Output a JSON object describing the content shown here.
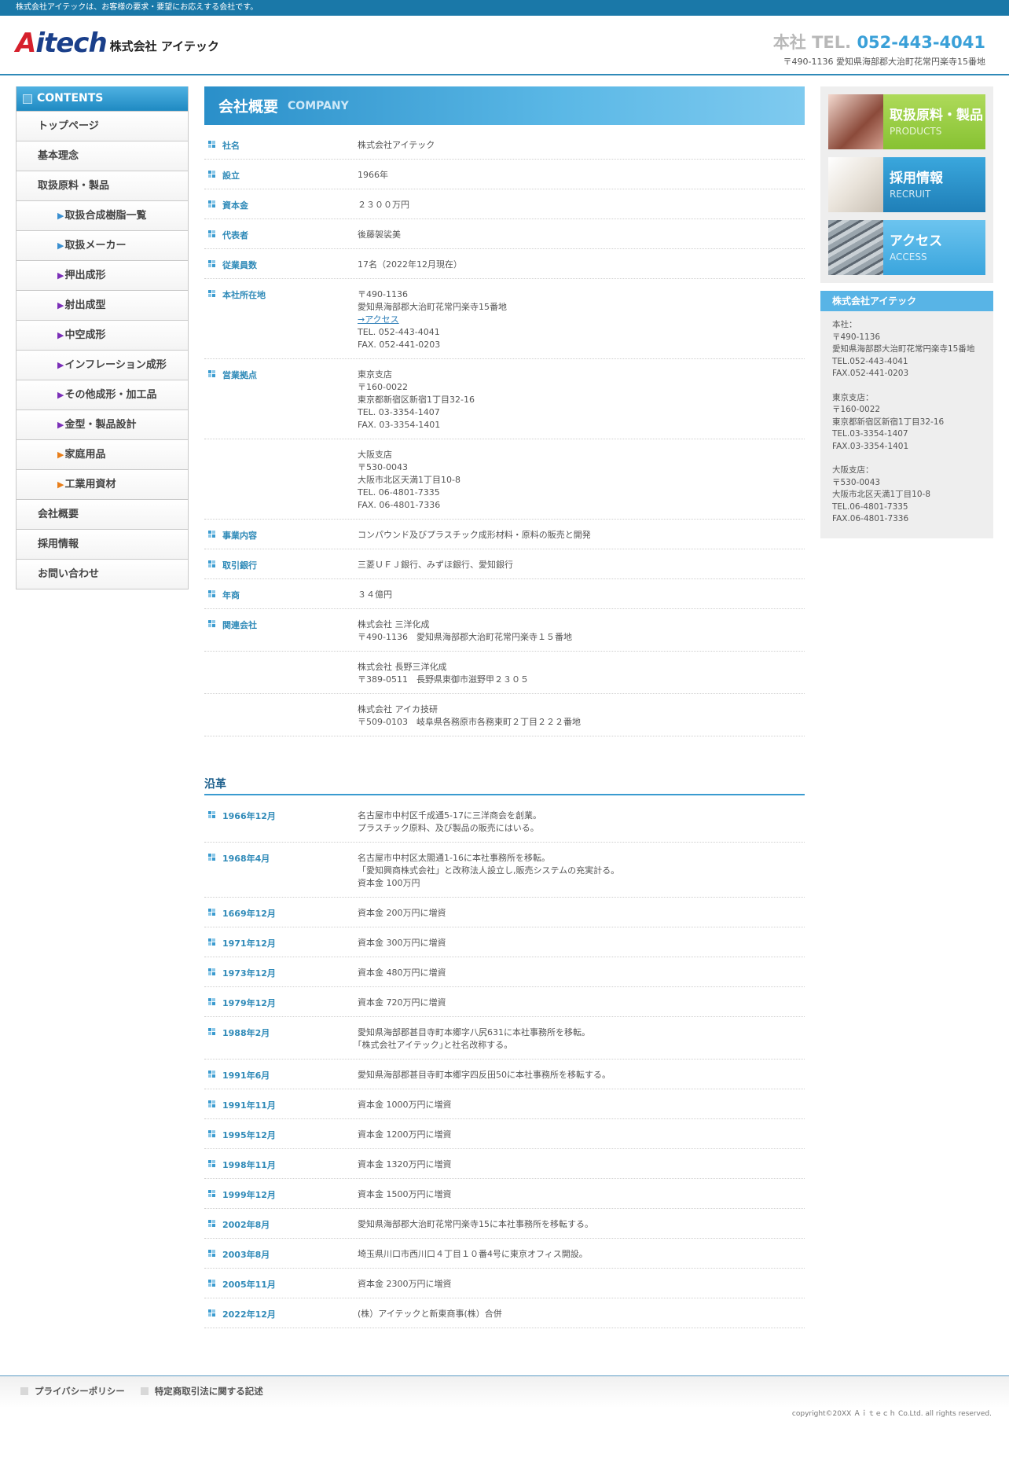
{
  "topbar": {
    "text": "株式会社アイテックは、お客様の要求・要望にお応えする会社です。"
  },
  "header": {
    "logo_mark_a": "A",
    "logo_mark_rest": "itech",
    "logo_jp": "株式会社 アイテック",
    "tel_label": "本社 TEL.",
    "tel_number": "052-443-4041",
    "address": "〒490-1136 愛知県海部郡大治町花常円楽寺15番地"
  },
  "sidebar": {
    "title": "CONTENTS",
    "items": [
      {
        "label": "トップページ",
        "sub": false
      },
      {
        "label": "基本理念",
        "sub": false
      },
      {
        "label": "取扱原料・製品",
        "sub": false
      },
      {
        "label": "取扱合成樹脂一覧",
        "sub": true,
        "tri": "▶",
        "tri_color": "#3a8fd0"
      },
      {
        "label": "取扱メーカー",
        "sub": true,
        "tri": "▶",
        "tri_color": "#3a8fd0"
      },
      {
        "label": "押出成形",
        "sub": true,
        "tri": "▶",
        "tri_color": "#7b2fb8"
      },
      {
        "label": "射出成型",
        "sub": true,
        "tri": "▶",
        "tri_color": "#7b2fb8"
      },
      {
        "label": "中空成形",
        "sub": true,
        "tri": "▶",
        "tri_color": "#7b2fb8"
      },
      {
        "label": "インフレーション成形",
        "sub": true,
        "tri": "▶",
        "tri_color": "#7b2fb8"
      },
      {
        "label": "その他成形・加工品",
        "sub": true,
        "tri": "▶",
        "tri_color": "#7b2fb8"
      },
      {
        "label": "金型・製品設計",
        "sub": true,
        "tri": "▶",
        "tri_color": "#7b2fb8"
      },
      {
        "label": "家庭用品",
        "sub": true,
        "tri": "▶",
        "tri_color": "#e87e1a"
      },
      {
        "label": "工業用資材",
        "sub": true,
        "tri": "▶",
        "tri_color": "#e87e1a"
      },
      {
        "label": "会社概要",
        "sub": false
      },
      {
        "label": "採用情報",
        "sub": false
      },
      {
        "label": "お問い合わせ",
        "sub": false
      }
    ]
  },
  "main": {
    "title_jp": "会社概要",
    "title_en": "COMPANY",
    "info": [
      {
        "key": "社名",
        "lines": [
          "株式会社アイテック"
        ]
      },
      {
        "key": "設立",
        "lines": [
          "1966年"
        ]
      },
      {
        "key": "資本金",
        "lines": [
          "２３００万円"
        ]
      },
      {
        "key": "代表者",
        "lines": [
          "後藤袈裟美"
        ]
      },
      {
        "key": "従業員数",
        "lines": [
          "17名（2022年12月現在）"
        ]
      },
      {
        "key": "本社所在地",
        "lines": [
          "〒490-1136",
          "愛知県海部郡大治町花常円楽寺15番地",
          "→アクセス",
          "TEL. 052-443-4041",
          "FAX. 052-441-0203"
        ],
        "link_index": 2
      },
      {
        "key": "営業拠点",
        "lines": [
          "東京支店",
          "〒160-0022",
          "東京都新宿区新宿1丁目32-16",
          "TEL. 03-3354-1407",
          "FAX. 03-3354-1401"
        ]
      },
      {
        "key": "",
        "lines": [
          "大阪支店",
          "〒530-0043",
          "大阪市北区天満1丁目10-8",
          "TEL. 06-4801-7335",
          "FAX. 06-4801-7336"
        ]
      },
      {
        "key": "事業内容",
        "lines": [
          "コンパウンド及びプラスチック成形材料・原料の販売と開発"
        ]
      },
      {
        "key": "取引銀行",
        "lines": [
          "三菱ＵＦＪ銀行、みずほ銀行、愛知銀行"
        ]
      },
      {
        "key": "年商",
        "lines": [
          "３４億円"
        ]
      },
      {
        "key": "関連会社",
        "lines": [
          "株式会社 三洋化成",
          "〒490-1136　愛知県海部郡大治町花常円楽寺１５番地"
        ]
      },
      {
        "key": "",
        "lines": [
          "株式会社 長野三洋化成",
          "〒389-0511　長野県東御市滋野甲２３０５"
        ]
      },
      {
        "key": "",
        "lines": [
          "株式会社 アイカ技研",
          "〒509-0103　岐阜県各務原市各務東町２丁目２２２番地"
        ]
      }
    ],
    "history_title": "沿革",
    "history": [
      {
        "key": "1966年12月",
        "lines": [
          "名古屋市中村区千成通5-17に三洋商会を創業。",
          "プラスチック原料、及び製品の販売にはいる。"
        ]
      },
      {
        "key": "1968年4月",
        "lines": [
          "名古屋市中村区太閤通1-16に本社事務所を移転。",
          "「愛知興商株式会社」と改称法人設立し,販売システムの充実計る。",
          "資本金 100万円"
        ]
      },
      {
        "key": "1669年12月",
        "lines": [
          "資本金 200万円に増資"
        ]
      },
      {
        "key": "1971年12月",
        "lines": [
          "資本金 300万円に増資"
        ]
      },
      {
        "key": "1973年12月",
        "lines": [
          "資本金 480万円に増資"
        ]
      },
      {
        "key": "1979年12月",
        "lines": [
          "資本金 720万円に増資"
        ]
      },
      {
        "key": "1988年2月",
        "lines": [
          "愛知県海部郡甚目寺町本郷字八尻631に本社事務所を移転。",
          "｢株式会社アイテック｣と社名改称する。"
        ]
      },
      {
        "key": "1991年6月",
        "lines": [
          "愛知県海部郡甚目寺町本郷字四反田50に本社事務所を移転する。"
        ]
      },
      {
        "key": "1991年11月",
        "lines": [
          "資本金 1000万円に増資"
        ]
      },
      {
        "key": "1995年12月",
        "lines": [
          "資本金 1200万円に増資"
        ]
      },
      {
        "key": "1998年11月",
        "lines": [
          "資本金 1320万円に増資"
        ]
      },
      {
        "key": "1999年12月",
        "lines": [
          "資本金 1500万円に増資"
        ]
      },
      {
        "key": "2002年8月",
        "lines": [
          "愛知県海部郡大治町花常円楽寺15に本社事務所を移転する。"
        ]
      },
      {
        "key": "2003年8月",
        "lines": [
          "埼玉県川口市西川口４丁目１０番4号に東京オフィス開設。"
        ]
      },
      {
        "key": "2005年11月",
        "lines": [
          "資本金 2300万円に増資"
        ]
      },
      {
        "key": "2022年12月",
        "lines": [
          "(株）アイテックと新東商事(株）合併"
        ]
      }
    ]
  },
  "right": {
    "banners": [
      {
        "jp": "取扱原料・製品",
        "en": "PRODUCTS",
        "cls": "b-products"
      },
      {
        "jp": "採用情報",
        "en": "RECRUIT",
        "cls": "b-recruit"
      },
      {
        "jp": "アクセス",
        "en": "ACCESS",
        "cls": "b-access"
      }
    ],
    "company_title": "株式会社アイテック",
    "company_blocks": [
      [
        "本社：",
        "〒490-1136",
        "愛知県海部郡大治町花常円楽寺15番地",
        "TEL.052-443-4041",
        "FAX.052-441-0203"
      ],
      [
        "東京支店：",
        "〒160-0022",
        "東京都新宿区新宿1丁目32-16",
        "TEL.03-3354-1407",
        "FAX.03-3354-1401"
      ],
      [
        "大阪支店：",
        "〒530-0043",
        "大阪市北区天満1丁目10-8",
        "TEL.06-4801-7335",
        "FAX.06-4801-7336"
      ]
    ]
  },
  "footer": {
    "links": [
      "プライバシーポリシー",
      "特定商取引法に関する記述"
    ],
    "copyright": "copyright©20XX Ａｉｔｅｃｈ Co.Ltd. all rights reserved."
  }
}
